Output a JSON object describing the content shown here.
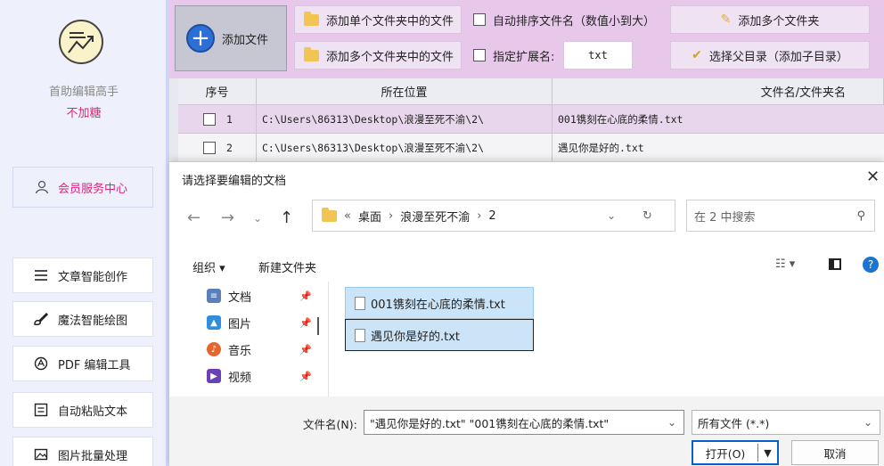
{
  "sidebar": {
    "app_name": "首助编辑高手",
    "app_sub": "不加糖",
    "member_label": "会员服务中心",
    "nav": [
      {
        "label": "文章智能创作",
        "icon": "list-lines-icon"
      },
      {
        "label": "魔法智能绘图",
        "icon": "brush-icon"
      },
      {
        "label": "PDF 编辑工具",
        "icon": "pdf-icon"
      },
      {
        "label": "自动粘贴文本",
        "icon": "paste-icon"
      },
      {
        "label": "图片批量处理",
        "icon": "image-icon"
      }
    ]
  },
  "toolbar": {
    "add_file": "添加文件",
    "add_single_folder": "添加单个文件夹中的文件",
    "add_multi_folder": "添加多个文件夹中的文件",
    "auto_sort": "自动排序文件名（数值小到大）",
    "specify_ext": "指定扩展名:",
    "ext_value": "txt",
    "add_multi_files": "添加多个文件夹",
    "select_parent": "选择父目录（添加子目录）"
  },
  "table": {
    "headers": [
      "序号",
      "所在位置",
      "文件名/文件夹名"
    ],
    "rows": [
      {
        "index": "1",
        "path": "C:\\Users\\86313\\Desktop\\浪漫至死不渝\\2\\",
        "name": "001镌刻在心底的柔情.txt"
      },
      {
        "index": "2",
        "path": "C:\\Users\\86313\\Desktop\\浪漫至死不渝\\2\\",
        "name": "遇见你是好的.txt"
      }
    ]
  },
  "dialog": {
    "title": "请选择要编辑的文档",
    "breadcrumb": [
      "«",
      "桌面",
      "›",
      "浪漫至死不渝",
      "›",
      "2"
    ],
    "search_placeholder": "在 2 中搜索",
    "organize": "组织 ▾",
    "new_folder": "新建文件夹",
    "nav_items": [
      {
        "label": "文档",
        "color": "#5b7fb8"
      },
      {
        "label": "图片",
        "color": "#2f8fdc"
      },
      {
        "label": "音乐",
        "color": "#e4662a"
      },
      {
        "label": "视频",
        "color": "#6b3fb8"
      }
    ],
    "files": [
      "001镌刻在心底的柔情.txt",
      "遇见你是好的.txt"
    ],
    "filename_label": "文件名(N):",
    "filename_value": "\"遇见你是好的.txt\" \"001镌刻在心底的柔情.txt\"",
    "filetype_value": "所有文件 (*.*)",
    "open_label": "打开(O)",
    "cancel_label": "取消"
  },
  "colors": {
    "accent": "#e0257d",
    "toolbar_bg": "#e8c8ea",
    "sidebar_bg": "#eef0fb",
    "select_blue": "#cce4f7"
  }
}
